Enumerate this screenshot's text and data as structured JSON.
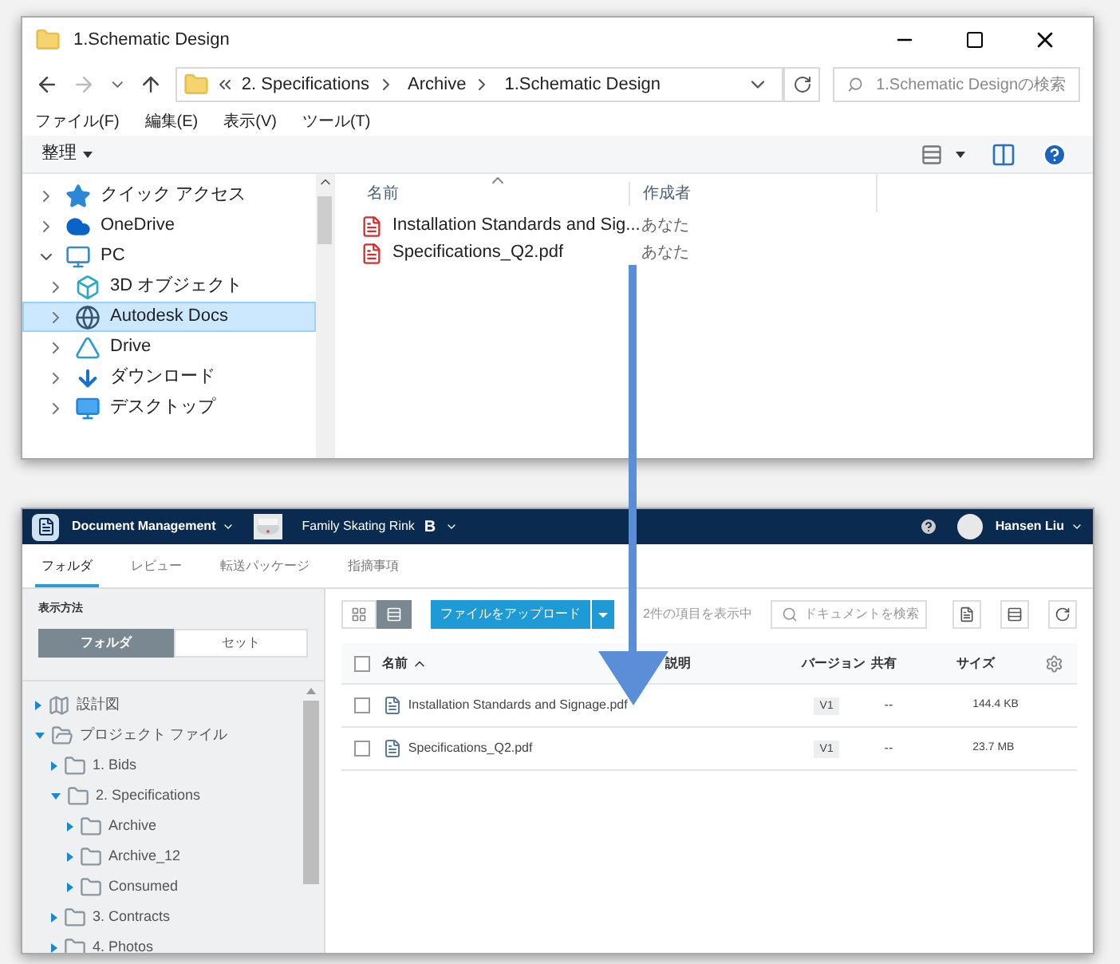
{
  "explorer": {
    "title": "1.Schematic Design",
    "breadcrumb": [
      "2. Specifications",
      "Archive",
      "1.Schematic Design"
    ],
    "search": {
      "placeholder": "1.Schematic Designの検索"
    },
    "menu": [
      "ファイル(F)",
      "編集(E)",
      "表示(V)",
      "ツール(T)"
    ],
    "organize": "整理",
    "nav": [
      {
        "label": "クイック アクセス",
        "kind": "star",
        "expanded": false,
        "selected": false
      },
      {
        "label": "OneDrive",
        "kind": "cloud",
        "expanded": false,
        "selected": false
      },
      {
        "label": "PC",
        "kind": "pc",
        "expanded": true,
        "selected": false,
        "children": [
          {
            "label": "3D オブジェクト",
            "kind": "cube",
            "expanded": false,
            "selected": false
          },
          {
            "label": "Autodesk Docs",
            "kind": "globe",
            "expanded": false,
            "selected": true
          },
          {
            "label": "Drive",
            "kind": "drive",
            "expanded": false,
            "selected": false
          },
          {
            "label": "ダウンロード",
            "kind": "download",
            "expanded": false,
            "selected": false
          },
          {
            "label": "デスクトップ",
            "kind": "desktop",
            "expanded": false,
            "selected": false
          }
        ]
      }
    ],
    "columns": [
      "名前",
      "作成者"
    ],
    "files": [
      {
        "name": "Installation Standards and Sig...",
        "author": "あなた"
      },
      {
        "name": "Specifications_Q2.pdf",
        "author": "あなた"
      }
    ]
  },
  "docs": {
    "app": "Document Management",
    "project": "Family Skating Rink",
    "project_badge": "B",
    "user": "Hansen Liu",
    "tabs": [
      {
        "label": "フォルダ",
        "selected": true
      },
      {
        "label": "レビュー",
        "selected": false
      },
      {
        "label": "転送パッケージ",
        "selected": false
      },
      {
        "label": "指摘事項",
        "selected": false
      }
    ],
    "view_label": "表示方法",
    "view_options": [
      {
        "label": "フォルダ",
        "selected": true
      },
      {
        "label": "セット",
        "selected": false
      }
    ],
    "tree": [
      {
        "label": "設計図",
        "kind": "drawings",
        "expanded": false
      },
      {
        "label": "プロジェクト ファイル",
        "kind": "project",
        "expanded": true,
        "children": [
          {
            "label": "1. Bids",
            "kind": "folder",
            "expanded": false
          },
          {
            "label": "2. Specifications",
            "kind": "folder",
            "expanded": true,
            "children": [
              {
                "label": "Archive",
                "kind": "folder",
                "expanded": false
              },
              {
                "label": "Archive_12",
                "kind": "folder",
                "expanded": false
              },
              {
                "label": "Consumed",
                "kind": "folder",
                "expanded": false
              }
            ]
          },
          {
            "label": "3. Contracts",
            "kind": "folder",
            "expanded": false
          },
          {
            "label": "4. Photos",
            "kind": "folder",
            "expanded": false
          }
        ]
      }
    ],
    "layouts": [
      {
        "kind": "grid",
        "selected": false
      },
      {
        "kind": "list",
        "selected": true
      }
    ],
    "upload": "ファイルをアップロード",
    "count": "2件の項目を表示中",
    "search": {
      "placeholder": "ドキュメントを検索"
    },
    "select_all": {
      "checked": false
    },
    "columns": [
      "名前",
      "説明",
      "バージョン",
      "共有",
      "サイズ"
    ],
    "rows": [
      {
        "name": "Installation Standards and Signage.pdf",
        "checked": false,
        "version": "V1",
        "shared": "--",
        "size": "144.4 KB"
      },
      {
        "name": "Specifications_Q2.pdf",
        "checked": false,
        "version": "V1",
        "shared": "--",
        "size": "23.7 MB"
      }
    ]
  }
}
